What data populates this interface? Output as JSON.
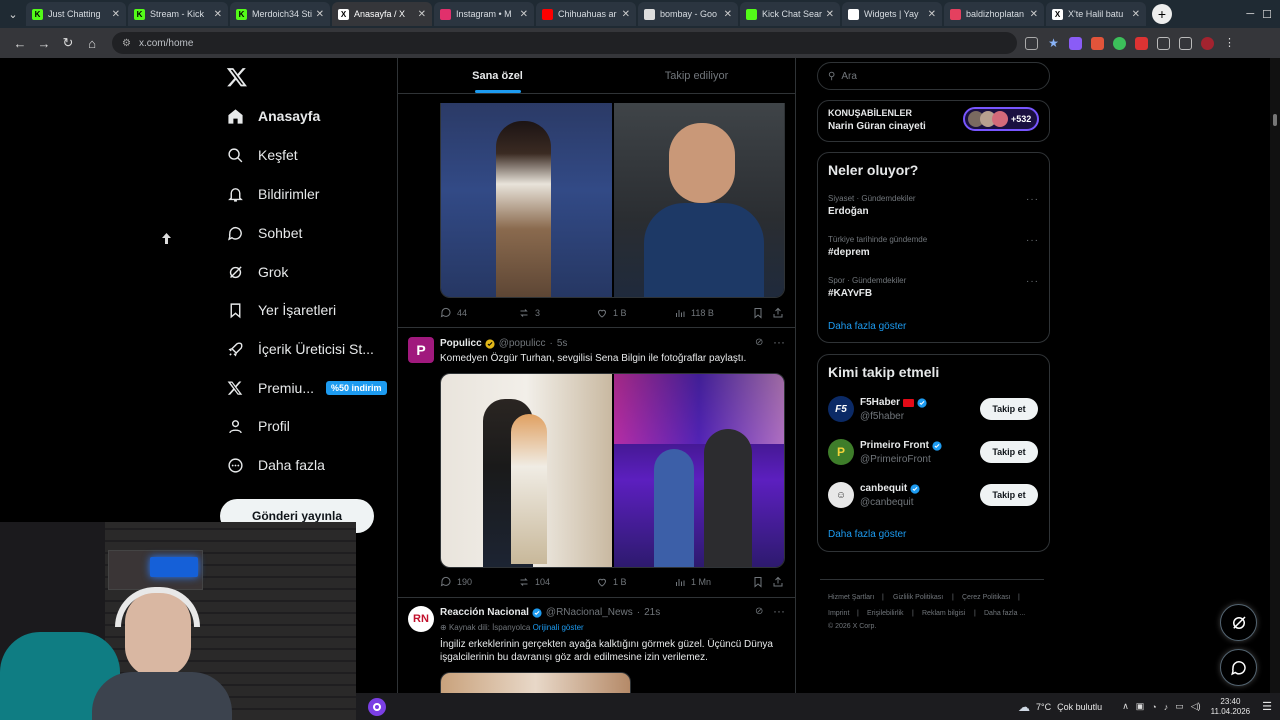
{
  "browser": {
    "tabs": [
      {
        "title": "Just Chatting",
        "favicon_color": "#53fc18",
        "favicon_letter": "K"
      },
      {
        "title": "Stream - Kick",
        "favicon_color": "#53fc18",
        "favicon_letter": "K"
      },
      {
        "title": "Merdoich34 Sti",
        "favicon_color": "#53fc18",
        "favicon_letter": "K"
      },
      {
        "title": "Anasayfa / X",
        "favicon_color": "#ffffff",
        "favicon_letter": "X",
        "active": true
      },
      {
        "title": "Instagram • M",
        "favicon_color": "#e1306c",
        "favicon_letter": ""
      },
      {
        "title": "Chihuahuas ar",
        "favicon_color": "#ff0000",
        "favicon_letter": ""
      },
      {
        "title": "bombay - Goo",
        "favicon_color": "#dddddd",
        "favicon_letter": ""
      },
      {
        "title": "Kick Chat Sear",
        "favicon_color": "#53fc18",
        "favicon_letter": ""
      },
      {
        "title": "Widgets | Yay",
        "favicon_color": "#ffffff",
        "favicon_letter": ""
      },
      {
        "title": "baldizhoplatan",
        "favicon_color": "#e4405f",
        "favicon_letter": ""
      },
      {
        "title": "X'te Halil batu",
        "favicon_color": "#ffffff",
        "favicon_letter": "X"
      }
    ],
    "url": "x.com/home"
  },
  "nav": {
    "items": [
      {
        "label": "Anasayfa",
        "icon": "home-icon"
      },
      {
        "label": "Keşfet",
        "icon": "search-icon"
      },
      {
        "label": "Bildirimler",
        "icon": "bell-icon"
      },
      {
        "label": "Sohbet",
        "icon": "chat-icon"
      },
      {
        "label": "Grok",
        "icon": "grok-icon"
      },
      {
        "label": "Yer İşaretleri",
        "icon": "bookmark-icon"
      },
      {
        "label": "İçerik Üreticisi St...",
        "icon": "rocket-icon"
      },
      {
        "label": "Premiu...",
        "icon": "x-icon"
      },
      {
        "label": "Profil",
        "icon": "person-icon"
      },
      {
        "label": "Daha fazla",
        "icon": "more-icon"
      }
    ],
    "premium_badge": "%50 indirim",
    "post_button": "Gönderi yayınla"
  },
  "feed": {
    "tabs": [
      "Sana özel",
      "Takip ediliyor"
    ],
    "post0_stats": {
      "replies": "44",
      "reposts": "3",
      "likes": "1 B",
      "views": "118 B"
    },
    "post1": {
      "name": "Populicc",
      "handle": "@populicc",
      "time": "5s",
      "text": "Komedyen Özgür Turhan, sevgilisi Sena Bilgin ile fotoğraflar paylaştı.",
      "stats": {
        "replies": "190",
        "reposts": "104",
        "likes": "1 B",
        "views": "1 Mn"
      }
    },
    "post2": {
      "name": "Reacción Nacional",
      "handle": "@RNacional_News",
      "time": "21s",
      "source_lang": "Kaynak dili: İspanyolca",
      "show_original": "Orijinali göster",
      "text": "İngiliz erkeklerinin gerçekten ayağa kalktığını görmek güzel. Üçüncü Dünya işgalcilerinin bu davranışı göz ardı edilmesine izin verilemez."
    }
  },
  "right": {
    "search_placeholder": "Ara",
    "spaces": {
      "label": "KONUŞABİLENLER",
      "topic": "Narin Güran cinayeti",
      "count": "+532"
    },
    "trends": {
      "title": "Neler oluyor?",
      "items": [
        {
          "context": "Siyaset · Gündemdekiler",
          "name": "Erdoğan"
        },
        {
          "context": "Türkiye tarihinde gündemde",
          "name": "#deprem"
        },
        {
          "context": "Spor · Gündemdekiler",
          "name": "#KAYvFB"
        }
      ],
      "more": "Daha fazla göster"
    },
    "who": {
      "title": "Kimi takip etmeli",
      "items": [
        {
          "name": "F5Haber",
          "handle": "@f5haber"
        },
        {
          "name": "Primeiro Front",
          "handle": "@PrimeiroFront"
        },
        {
          "name": "canbequit",
          "handle": "@canbequit"
        }
      ],
      "follow_label": "Takip et",
      "more": "Daha fazla göster"
    },
    "footer": [
      "Hizmet Şartları",
      "Gizlilik Politikası",
      "Çerez Politikası",
      "Imprint",
      "Erişilebilirlik",
      "Reklam bilgisi",
      "Daha fazla ...",
      "© 2026 X Corp."
    ]
  },
  "taskbar": {
    "weather_temp": "7°C",
    "weather_desc": "Çok bulutlu",
    "time": "23:40",
    "date": "11.04.2026"
  },
  "colors": {
    "accent": "#1d9bf0",
    "background": "#000000",
    "border": "#2f3336",
    "muted": "#71767b"
  }
}
